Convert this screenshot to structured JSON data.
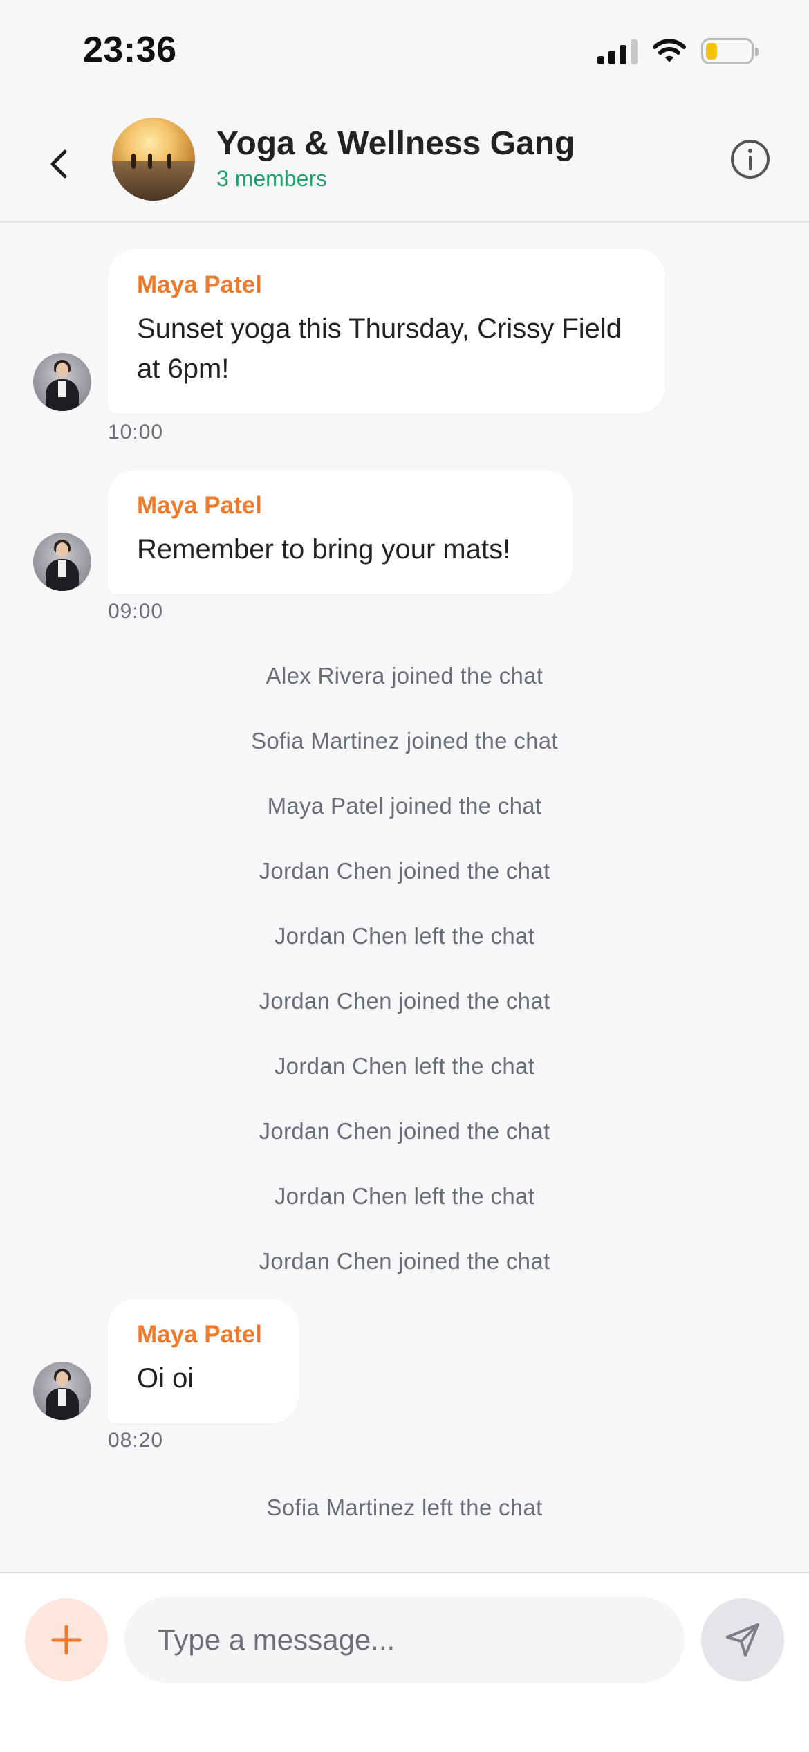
{
  "status_bar": {
    "time": "23:36"
  },
  "header": {
    "title": "Yoga & Wellness Gang",
    "subtitle": "3 members",
    "accent_color": "#1fa36a"
  },
  "messages": [
    {
      "sender": "Maya Patel",
      "text": "Sunset yoga this Thursday, Crissy Field at 6pm!",
      "time": "10:00"
    },
    {
      "sender": "Maya Patel",
      "text": "Remember to bring your mats!",
      "time": "09:00"
    },
    {
      "sender": "Maya Patel",
      "text": "Oi oi",
      "time": "08:20"
    }
  ],
  "system_events": [
    "Alex Rivera joined the chat",
    "Sofia Martinez joined the chat",
    "Maya Patel joined the chat",
    "Jordan Chen joined the chat",
    "Jordan Chen left the chat",
    "Jordan Chen joined the chat",
    "Jordan Chen left the chat",
    "Jordan Chen joined the chat",
    "Jordan Chen left the chat",
    "Jordan Chen joined the chat",
    "Sofia Martinez left the chat"
  ],
  "composer": {
    "placeholder": "Type a message...",
    "value": ""
  },
  "colors": {
    "sender_name": "#f07a2c",
    "add_button_bg": "#fde6de",
    "send_button_bg": "#e4e5e8"
  },
  "icons": {
    "back": "chevron-left-icon",
    "info": "info-icon",
    "add": "plus-icon",
    "send": "send-icon"
  }
}
